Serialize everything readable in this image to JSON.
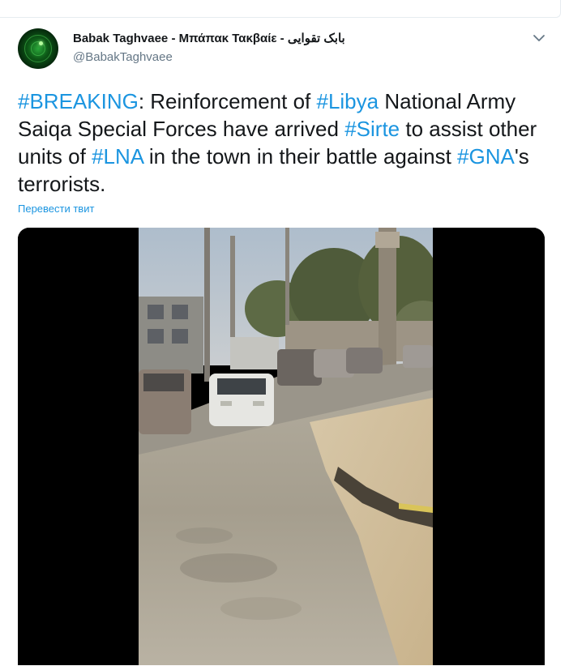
{
  "author": {
    "display_name": "Babak Taghvaee - Μπάπακ Τακβαίε - بابک تقوایی",
    "handle": "@BabakTaghvaee"
  },
  "tweet": {
    "segments": [
      {
        "text": "#BREAKING",
        "is_hashtag": true
      },
      {
        "text": ": Reinforcement of ",
        "is_hashtag": false
      },
      {
        "text": "#Libya",
        "is_hashtag": true
      },
      {
        "text": " National Army Saiqa Special Forces have arrived ",
        "is_hashtag": false
      },
      {
        "text": "#Sirte",
        "is_hashtag": true
      },
      {
        "text": " to assist other units of ",
        "is_hashtag": false
      },
      {
        "text": "#LNA",
        "is_hashtag": true
      },
      {
        "text": " in the town in their battle against ",
        "is_hashtag": false
      },
      {
        "text": "#GNA",
        "is_hashtag": true
      },
      {
        "text": "'s terrorists.",
        "is_hashtag": false
      }
    ],
    "translate_label": "Перевести твит"
  },
  "media": {
    "type": "video",
    "description_icon": "video-thumbnail"
  },
  "colors": {
    "hashtag": "#1b95e0",
    "text": "#14171a",
    "secondary": "#657786"
  },
  "icons": {
    "more": "chevron-down-icon"
  }
}
